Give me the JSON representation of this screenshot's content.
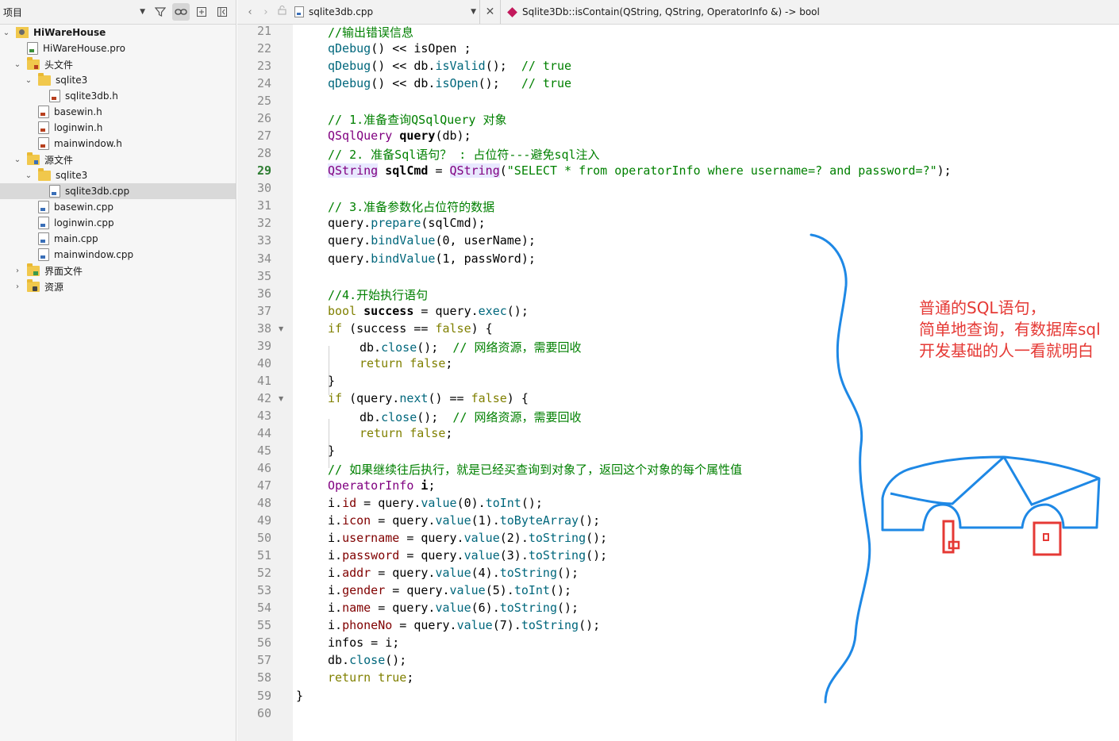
{
  "project_panel": {
    "title": "项目",
    "tree": [
      {
        "label": "HiWareHouse",
        "depth": 0,
        "arrow": "down",
        "icon": "project-icon",
        "bold": true
      },
      {
        "label": "HiWareHouse.pro",
        "depth": 1,
        "arrow": "",
        "icon": "pro-file-icon"
      },
      {
        "label": "头文件",
        "depth": 1,
        "arrow": "down",
        "icon": "header-folder-icon"
      },
      {
        "label": "sqlite3",
        "depth": 2,
        "arrow": "down",
        "icon": "folder-icon"
      },
      {
        "label": "sqlite3db.h",
        "depth": 3,
        "arrow": "",
        "icon": "header-file-icon"
      },
      {
        "label": "basewin.h",
        "depth": 2,
        "arrow": "",
        "icon": "header-file-icon"
      },
      {
        "label": "loginwin.h",
        "depth": 2,
        "arrow": "",
        "icon": "header-file-icon"
      },
      {
        "label": "mainwindow.h",
        "depth": 2,
        "arrow": "",
        "icon": "header-file-icon"
      },
      {
        "label": "源文件",
        "depth": 1,
        "arrow": "down",
        "icon": "source-folder-icon"
      },
      {
        "label": "sqlite3",
        "depth": 2,
        "arrow": "down",
        "icon": "folder-icon"
      },
      {
        "label": "sqlite3db.cpp",
        "depth": 3,
        "arrow": "",
        "icon": "cpp-file-icon",
        "selected": true
      },
      {
        "label": "basewin.cpp",
        "depth": 2,
        "arrow": "",
        "icon": "cpp-file-icon"
      },
      {
        "label": "loginwin.cpp",
        "depth": 2,
        "arrow": "",
        "icon": "cpp-file-icon"
      },
      {
        "label": "main.cpp",
        "depth": 2,
        "arrow": "",
        "icon": "cpp-file-icon"
      },
      {
        "label": "mainwindow.cpp",
        "depth": 2,
        "arrow": "",
        "icon": "cpp-file-icon"
      },
      {
        "label": "界面文件",
        "depth": 1,
        "arrow": "right",
        "icon": "forms-folder-icon"
      },
      {
        "label": "资源",
        "depth": 1,
        "arrow": "right",
        "icon": "resources-folder-icon"
      }
    ]
  },
  "editor": {
    "file_name": "sqlite3db.cpp",
    "function_signature": "Sqlite3Db::isContain(QString, QString, OperatorInfo &) -> bool",
    "current_line": 29,
    "lines": [
      {
        "n": 21,
        "indent": 4,
        "tokens": [
          [
            "c",
            "//输出错误信息"
          ]
        ]
      },
      {
        "n": 22,
        "indent": 4,
        "tokens": [
          [
            "f",
            "qDebug"
          ],
          [
            "",
            "() << isOpen ;"
          ]
        ]
      },
      {
        "n": 23,
        "indent": 4,
        "tokens": [
          [
            "f",
            "qDebug"
          ],
          [
            "",
            "() << db."
          ],
          [
            "f",
            "isValid"
          ],
          [
            "",
            "();  "
          ],
          [
            "c",
            "// true"
          ]
        ]
      },
      {
        "n": 24,
        "indent": 4,
        "tokens": [
          [
            "f",
            "qDebug"
          ],
          [
            "",
            "() << db."
          ],
          [
            "f",
            "isOpen"
          ],
          [
            "",
            "();   "
          ],
          [
            "c",
            "// true"
          ]
        ]
      },
      {
        "n": 25,
        "indent": 0,
        "tokens": []
      },
      {
        "n": 26,
        "indent": 4,
        "tokens": [
          [
            "c",
            "// 1.准备查询QSqlQuery 对象"
          ]
        ]
      },
      {
        "n": 27,
        "indent": 4,
        "tokens": [
          [
            "t",
            "QSqlQuery"
          ],
          [
            "",
            " "
          ],
          [
            "b",
            "query"
          ],
          [
            "",
            "(db);"
          ]
        ]
      },
      {
        "n": 28,
        "indent": 4,
        "tokens": [
          [
            "c",
            "// 2. 准备Sql语句？ : 占位符---避免sql注入"
          ]
        ]
      },
      {
        "n": 29,
        "indent": 4,
        "tokens": [
          [
            "th",
            "QString"
          ],
          [
            "",
            " "
          ],
          [
            "b",
            "sqlCmd"
          ],
          [
            "",
            " = "
          ],
          [
            "th",
            "QString"
          ],
          [
            "",
            "("
          ],
          [
            "s",
            "\"SELECT * from operatorInfo where username=? and password=?\""
          ],
          [
            "",
            ");"
          ]
        ]
      },
      {
        "n": 30,
        "indent": 0,
        "tokens": []
      },
      {
        "n": 31,
        "indent": 4,
        "tokens": [
          [
            "c",
            "// 3.准备参数化占位符的数据"
          ]
        ]
      },
      {
        "n": 32,
        "indent": 4,
        "tokens": [
          [
            "",
            "query."
          ],
          [
            "f",
            "prepare"
          ],
          [
            "",
            "(sqlCmd);"
          ]
        ]
      },
      {
        "n": 33,
        "indent": 4,
        "tokens": [
          [
            "",
            "query."
          ],
          [
            "f",
            "bindValue"
          ],
          [
            "",
            "(0, userName);"
          ]
        ]
      },
      {
        "n": 34,
        "indent": 4,
        "tokens": [
          [
            "",
            "query."
          ],
          [
            "f",
            "bindValue"
          ],
          [
            "",
            "(1, passWord);"
          ]
        ]
      },
      {
        "n": 35,
        "indent": 0,
        "tokens": []
      },
      {
        "n": 36,
        "indent": 4,
        "tokens": [
          [
            "c",
            "//4.开始执行语句"
          ]
        ]
      },
      {
        "n": 37,
        "indent": 4,
        "tokens": [
          [
            "k",
            "bool"
          ],
          [
            "",
            " "
          ],
          [
            "b",
            "success"
          ],
          [
            "",
            " = query."
          ],
          [
            "f",
            "exec"
          ],
          [
            "",
            "();"
          ]
        ]
      },
      {
        "n": 38,
        "indent": 4,
        "fold": true,
        "tokens": [
          [
            "k",
            "if"
          ],
          [
            "",
            " (success == "
          ],
          [
            "k",
            "false"
          ],
          [
            "",
            ") {"
          ]
        ]
      },
      {
        "n": 39,
        "indent": 8,
        "tokens": [
          [
            "",
            "db."
          ],
          [
            "f",
            "close"
          ],
          [
            "",
            "();  "
          ],
          [
            "c",
            "// 网络资源，需要回收"
          ]
        ]
      },
      {
        "n": 40,
        "indent": 8,
        "tokens": [
          [
            "k",
            "return"
          ],
          [
            "",
            " "
          ],
          [
            "k",
            "false"
          ],
          [
            "",
            ";"
          ]
        ]
      },
      {
        "n": 41,
        "indent": 4,
        "tokens": [
          [
            "",
            "}"
          ]
        ]
      },
      {
        "n": 42,
        "indent": 4,
        "fold": true,
        "tokens": [
          [
            "k",
            "if"
          ],
          [
            "",
            " (query."
          ],
          [
            "f",
            "next"
          ],
          [
            "",
            "() == "
          ],
          [
            "k",
            "false"
          ],
          [
            "",
            ") {"
          ]
        ]
      },
      {
        "n": 43,
        "indent": 8,
        "tokens": [
          [
            "",
            "db."
          ],
          [
            "f",
            "close"
          ],
          [
            "",
            "();  "
          ],
          [
            "c",
            "// 网络资源，需要回收"
          ]
        ]
      },
      {
        "n": 44,
        "indent": 8,
        "tokens": [
          [
            "k",
            "return"
          ],
          [
            "",
            " "
          ],
          [
            "k",
            "false"
          ],
          [
            "",
            ";"
          ]
        ]
      },
      {
        "n": 45,
        "indent": 4,
        "tokens": [
          [
            "",
            "}"
          ]
        ]
      },
      {
        "n": 46,
        "indent": 4,
        "tokens": [
          [
            "c",
            "// 如果继续往后执行，就是已经买查询到对象了，返回这个对象的每个属性值"
          ]
        ]
      },
      {
        "n": 47,
        "indent": 4,
        "tokens": [
          [
            "t",
            "OperatorInfo"
          ],
          [
            "",
            " "
          ],
          [
            "b",
            "i"
          ],
          [
            "",
            ";"
          ]
        ]
      },
      {
        "n": 48,
        "indent": 4,
        "tokens": [
          [
            "",
            "i."
          ],
          [
            "m",
            "id"
          ],
          [
            "",
            " = query."
          ],
          [
            "f",
            "value"
          ],
          [
            "",
            "(0)."
          ],
          [
            "f",
            "toInt"
          ],
          [
            "",
            "();"
          ]
        ]
      },
      {
        "n": 49,
        "indent": 4,
        "tokens": [
          [
            "",
            "i."
          ],
          [
            "m",
            "icon"
          ],
          [
            "",
            " = query."
          ],
          [
            "f",
            "value"
          ],
          [
            "",
            "(1)."
          ],
          [
            "f",
            "toByteArray"
          ],
          [
            "",
            "();"
          ]
        ]
      },
      {
        "n": 50,
        "indent": 4,
        "tokens": [
          [
            "",
            "i."
          ],
          [
            "m",
            "username"
          ],
          [
            "",
            " = query."
          ],
          [
            "f",
            "value"
          ],
          [
            "",
            "(2)."
          ],
          [
            "f",
            "toString"
          ],
          [
            "",
            "();"
          ]
        ]
      },
      {
        "n": 51,
        "indent": 4,
        "tokens": [
          [
            "",
            "i."
          ],
          [
            "m",
            "password"
          ],
          [
            "",
            " = query."
          ],
          [
            "f",
            "value"
          ],
          [
            "",
            "(3)."
          ],
          [
            "f",
            "toString"
          ],
          [
            "",
            "();"
          ]
        ]
      },
      {
        "n": 52,
        "indent": 4,
        "tokens": [
          [
            "",
            "i."
          ],
          [
            "m",
            "addr"
          ],
          [
            "",
            " = query."
          ],
          [
            "f",
            "value"
          ],
          [
            "",
            "(4)."
          ],
          [
            "f",
            "toString"
          ],
          [
            "",
            "();"
          ]
        ]
      },
      {
        "n": 53,
        "indent": 4,
        "tokens": [
          [
            "",
            "i."
          ],
          [
            "m",
            "gender"
          ],
          [
            "",
            " = query."
          ],
          [
            "f",
            "value"
          ],
          [
            "",
            "(5)."
          ],
          [
            "f",
            "toInt"
          ],
          [
            "",
            "();"
          ]
        ]
      },
      {
        "n": 54,
        "indent": 4,
        "tokens": [
          [
            "",
            "i."
          ],
          [
            "m",
            "name"
          ],
          [
            "",
            " = query."
          ],
          [
            "f",
            "value"
          ],
          [
            "",
            "(6)."
          ],
          [
            "f",
            "toString"
          ],
          [
            "",
            "();"
          ]
        ]
      },
      {
        "n": 55,
        "indent": 4,
        "tokens": [
          [
            "",
            "i."
          ],
          [
            "m",
            "phoneNo"
          ],
          [
            "",
            " = query."
          ],
          [
            "f",
            "value"
          ],
          [
            "",
            "(7)."
          ],
          [
            "f",
            "toString"
          ],
          [
            "",
            "();"
          ]
        ]
      },
      {
        "n": 56,
        "indent": 4,
        "tokens": [
          [
            "",
            "infos = i;"
          ]
        ]
      },
      {
        "n": 57,
        "indent": 4,
        "tokens": [
          [
            "",
            "db."
          ],
          [
            "f",
            "close"
          ],
          [
            "",
            "();"
          ]
        ]
      },
      {
        "n": 58,
        "indent": 4,
        "tokens": [
          [
            "k",
            "return"
          ],
          [
            "",
            " "
          ],
          [
            "k",
            "true"
          ],
          [
            "",
            ";"
          ]
        ]
      },
      {
        "n": 59,
        "indent": 0,
        "tokens": [
          [
            "",
            "}"
          ]
        ]
      },
      {
        "n": 60,
        "indent": 0,
        "tokens": []
      }
    ]
  },
  "annotation": {
    "lines": [
      "普通的SQL语句，",
      "简单地查询，有数据库sql",
      "开发基础的人一看就明白"
    ],
    "text_color": "#e53935",
    "drawing_color": "#1e88e5",
    "marker_color": "#e53935"
  },
  "icons": {
    "filter": "filter-icon",
    "link": "link-icon",
    "split": "split-icon",
    "back": "back-arrow-icon",
    "forward": "forward-arrow-icon",
    "lock": "lock-icon",
    "close": "close-icon",
    "function": "function-diamond-icon"
  }
}
